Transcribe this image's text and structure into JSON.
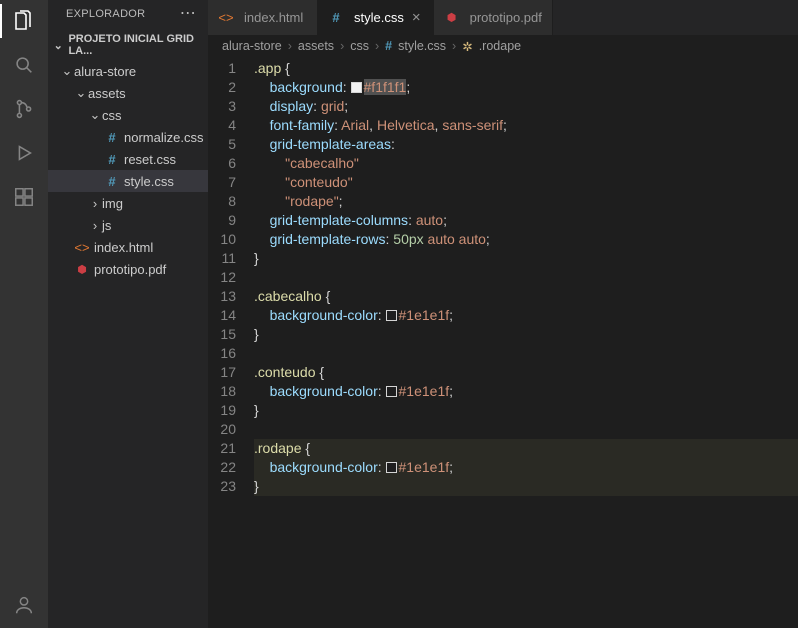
{
  "explorer": {
    "title": "EXPLORADOR",
    "project": "PROJETO INICIAL GRID LA...",
    "tree": {
      "root": "alura-store",
      "assets": "assets",
      "css": "css",
      "normalize": "normalize.css",
      "reset": "reset.css",
      "style": "style.css",
      "img": "img",
      "js": "js",
      "index": "index.html",
      "prototipo": "prototipo.pdf"
    }
  },
  "tabs": {
    "t1": "index.html",
    "t2": "style.css",
    "t3": "prototipo.pdf"
  },
  "breadcrumb": {
    "p1": "alura-store",
    "p2": "assets",
    "p3": "css",
    "p4": "style.css",
    "p5": ".rodape"
  },
  "lines": {
    "l1": "1",
    "l2": "2",
    "l3": "3",
    "l4": "4",
    "l5": "5",
    "l6": "6",
    "l7": "7",
    "l8": "8",
    "l9": "9",
    "l10": "10",
    "l11": "11",
    "l12": "12",
    "l13": "13",
    "l14": "14",
    "l15": "15",
    "l16": "16",
    "l17": "17",
    "l18": "18",
    "l19": "19",
    "l20": "20",
    "l21": "21",
    "l22": "22",
    "l23": "23"
  },
  "code": {
    "sel_app": ".app",
    "brace_open": " {",
    "brace_close": "}",
    "background": "background",
    "display": "display",
    "grid": "grid",
    "fontfamily": "font-family",
    "arial": "Arial",
    "helvetica": "Helvetica",
    "sans": "sans-serif",
    "gta": "grid-template-areas",
    "cab": "\"cabecalho\"",
    "cont": "\"conteudo\"",
    "rod": "\"rodape\"",
    "gtc": "grid-template-columns",
    "auto": "auto",
    "gtr": "grid-template-rows",
    "fifty": "50px",
    "sel_cab": ".cabecalho",
    "sel_con": ".conteudo",
    "sel_rod": ".rodape",
    "bgc": "background-color",
    "f1": "#f1f1f1",
    "dark": "#1e1e1f",
    "colon": ":",
    "semi": ";",
    "comma": ", "
  }
}
